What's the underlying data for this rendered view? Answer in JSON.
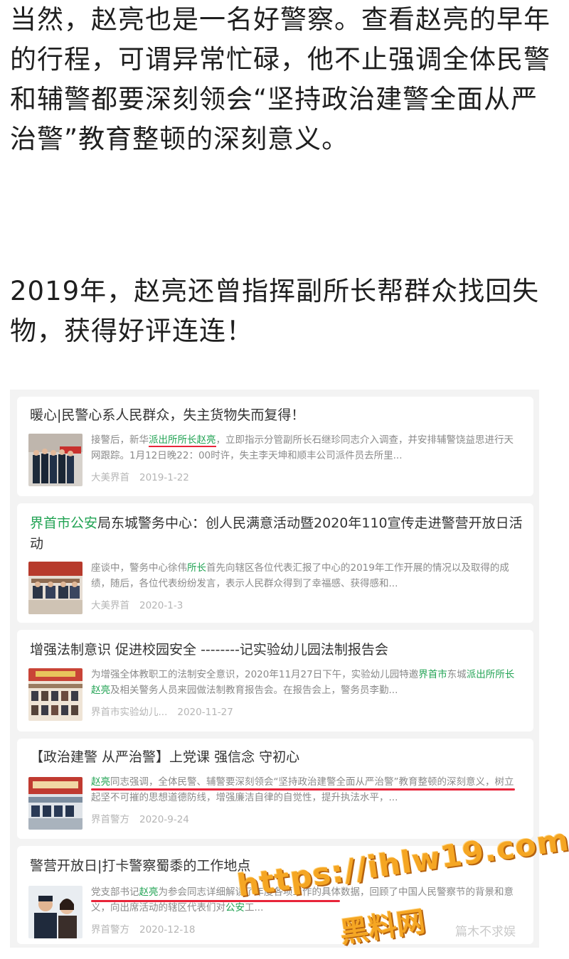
{
  "article": {
    "paragraph_1": "当然，赵亮也是一名好警察。查看赵亮的早年的行程，可谓异常忙碌，他不止强调全体民警和辅警都要深刻领会“坚持政治建警全面从严治警”教育整顿的深刻意义。",
    "paragraph_2": "2019年，赵亮还曾指挥副所长帮群众找回失物，获得好评连连！"
  },
  "results": [
    {
      "title": "暖心|民警心系人民群众，失主货物失而复得！",
      "snippet_pre": "接警后，新华",
      "snippet_hl": "派出所所长赵亮",
      "snippet_post": "，立即指示分管副所长石继珍同志介入调查，并安排辅警饶益思进行天网跟踪。1月12日晚22：00时许，失主李天坤和顺丰公司派件员去所里...",
      "source": "大美界首",
      "date": "2019-1-22"
    },
    {
      "title_hl": "界首市公安",
      "title_rest": "局东城警务中心：创人民满意活动暨2020年110宣传走进警营开放日活动",
      "snippet_pre": "座谈中，警务中心徐伟",
      "snippet_hl": "所长",
      "snippet_post": "首先向辖区各位代表汇报了中心的2019年工作开展的情况以及取得的成绩，随后，各位代表纷纷发言，表示人民群众得到了幸福感、获得感和...",
      "source": "大美界首",
      "date": "2020-1-3"
    },
    {
      "title": "增强法制意识 促进校园安全 --------记实验幼儿园法制报告会",
      "snippet_pre": "为增强全体教职工的法制安全意识，2020年11月27日下午，实验幼儿园特邀",
      "snippet_hl": "界首市",
      "snippet_mid": "东城",
      "snippet_hl2": "派出所所长赵亮",
      "snippet_post": "及相关警务人员来园做法制教育报告会。在报告会上，警务员李勤...",
      "source": "界首市实验幼儿...",
      "date": "2020-11-27"
    },
    {
      "title": "【政治建警 从严治警】上党课 强信念 守初心",
      "snippet_hl": "赵亮",
      "snippet_post": "同志强调，全体民警、辅警要深刻领会“坚持政治建警全面从严治警”教育整顿的深刻意义，树立起坚不可摧的思想道德防线，增强廉洁自律的自觉性，提升执法水平，...",
      "source": "界首警方",
      "date": "2020-9-24"
    },
    {
      "title": "警营开放日|打卡警察蜀黍的工作地点",
      "snippet_pre": "党支部书记",
      "snippet_hl": "赵亮",
      "snippet_post": "为参会同志详细解读了年度各项工作的具体数据，回顾了中国人民警察节的背景和意义，向出席活动的辖区代表们对",
      "snippet_hl2": "公安",
      "snippet_tail": "工...",
      "source": "界首警方",
      "date": "2020-12-18"
    }
  ],
  "watermark": {
    "url": "https://ihlw19.com",
    "site": "黑料网",
    "corner": "篇木不求娱"
  },
  "colors": {
    "highlight": "#22a354",
    "underline": "#e8253a",
    "watermark": "#f5a623"
  }
}
